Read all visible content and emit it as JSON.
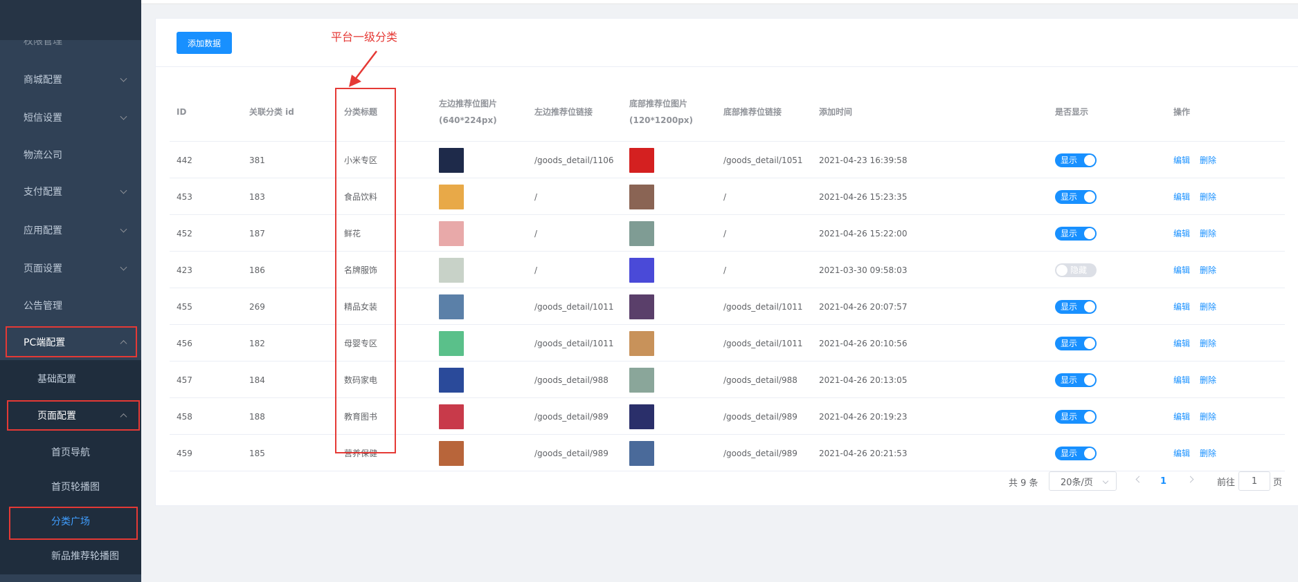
{
  "sidebar": {
    "items": [
      {
        "label": "权限管理",
        "chevron": false
      },
      {
        "label": "商城配置",
        "chevron": true
      },
      {
        "label": "短信设置",
        "chevron": true
      },
      {
        "label": "物流公司",
        "chevron": false
      },
      {
        "label": "支付配置",
        "chevron": true
      },
      {
        "label": "应用配置",
        "chevron": true
      },
      {
        "label": "页面设置",
        "chevron": true
      },
      {
        "label": "公告管理",
        "chevron": false
      },
      {
        "label": "PC端配置",
        "chevron": true
      },
      {
        "label": "基础配置"
      },
      {
        "label": "页面配置"
      },
      {
        "label": "首页导航"
      },
      {
        "label": "首页轮播图"
      },
      {
        "label": "分类广场"
      },
      {
        "label": "新品推荐轮播图"
      }
    ]
  },
  "toolbar": {
    "add_label": "添加数据"
  },
  "annotation": {
    "text": "平台一级分类",
    "color": "#e53935"
  },
  "table": {
    "headers": {
      "id": "ID",
      "cat_id": "关联分类 id",
      "title": "分类标题",
      "left_img": "左边推荐位图片(640*224px)",
      "left_link": "左边推荐位链接",
      "bottom_img": "底部推荐位图片(120*1200px)",
      "bottom_link": "底部推荐位链接",
      "time": "添加时间",
      "show": "是否显示",
      "ops": "操作"
    },
    "rows": [
      {
        "id": "442",
        "cat_id": "381",
        "title": "小米专区",
        "left_link": "/goods_detail/1106",
        "bottom_link": "/goods_detail/1051",
        "time": "2021-04-23 16:39:58",
        "show": "显示",
        "on": true,
        "left_color": "#1e2a4a",
        "bottom_color": "#d42020"
      },
      {
        "id": "453",
        "cat_id": "183",
        "title": "食品饮料",
        "left_link": "/",
        "bottom_link": "/",
        "time": "2021-04-26 15:23:35",
        "show": "显示",
        "on": true,
        "left_color": "#e8a948",
        "bottom_color": "#8a6454"
      },
      {
        "id": "452",
        "cat_id": "187",
        "title": "鲜花",
        "left_link": "/",
        "bottom_link": "/",
        "time": "2021-04-26 15:22:00",
        "show": "显示",
        "on": true,
        "left_color": "#e8a9a9",
        "bottom_color": "#7f9c94"
      },
      {
        "id": "423",
        "cat_id": "186",
        "title": "名牌服饰",
        "left_link": "/",
        "bottom_link": "/",
        "time": "2021-03-30 09:58:03",
        "show": "隐藏",
        "on": false,
        "left_color": "#c8d2c8",
        "bottom_color": "#4a4ad8"
      },
      {
        "id": "455",
        "cat_id": "269",
        "title": "精品女装",
        "left_link": "/goods_detail/1011",
        "bottom_link": "/goods_detail/1011",
        "time": "2021-04-26 20:07:57",
        "show": "显示",
        "on": true,
        "left_color": "#5b80a8",
        "bottom_color": "#5a3f6a"
      },
      {
        "id": "456",
        "cat_id": "182",
        "title": "母婴专区",
        "left_link": "/goods_detail/1011",
        "bottom_link": "/goods_detail/1011",
        "time": "2021-04-26 20:10:56",
        "show": "显示",
        "on": true,
        "left_color": "#5ac08a",
        "bottom_color": "#c8925a"
      },
      {
        "id": "457",
        "cat_id": "184",
        "title": "数码家电",
        "left_link": "/goods_detail/988",
        "bottom_link": "/goods_detail/988",
        "time": "2021-04-26 20:13:05",
        "show": "显示",
        "on": true,
        "left_color": "#2a4a9a",
        "bottom_color": "#8aa69a"
      },
      {
        "id": "458",
        "cat_id": "188",
        "title": "教育图书",
        "left_link": "/goods_detail/989",
        "bottom_link": "/goods_detail/989",
        "time": "2021-04-26 20:19:23",
        "show": "显示",
        "on": true,
        "left_color": "#c83a4a",
        "bottom_color": "#2a2f6a"
      },
      {
        "id": "459",
        "cat_id": "185",
        "title": "营养保健",
        "left_link": "/goods_detail/989",
        "bottom_link": "/goods_detail/989",
        "time": "2021-04-26 20:21:53",
        "show": "显示",
        "on": true,
        "left_color": "#b8653a",
        "bottom_color": "#4a6a9a"
      }
    ],
    "edit_label": "编辑",
    "delete_label": "删除"
  },
  "pagination": {
    "total_text": "共 9 条",
    "page_size": "20条/页",
    "current_page": "1",
    "goto_prefix": "前往",
    "goto_value": "1",
    "goto_suffix": "页"
  }
}
